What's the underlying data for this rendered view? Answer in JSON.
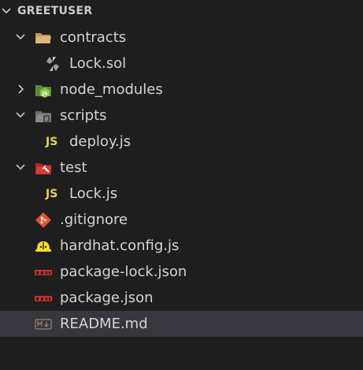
{
  "explorer": {
    "title": "GREETUSER",
    "items": [
      {
        "label": "contracts",
        "icon": "folder-open-icon"
      },
      {
        "label": "Lock.sol",
        "icon": "solidity-icon"
      },
      {
        "label": "node_modules",
        "icon": "node-folder-icon"
      },
      {
        "label": "scripts",
        "icon": "scripts-folder-icon"
      },
      {
        "label": "deploy.js",
        "icon": "js-icon",
        "badge": "JS"
      },
      {
        "label": "test",
        "icon": "test-folder-icon"
      },
      {
        "label": "Lock.js",
        "icon": "js-icon",
        "badge": "JS"
      },
      {
        "label": ".gitignore",
        "icon": "git-icon"
      },
      {
        "label": "hardhat.config.js",
        "icon": "hardhat-icon"
      },
      {
        "label": "package-lock.json",
        "icon": "npm-icon"
      },
      {
        "label": "package.json",
        "icon": "npm-icon"
      },
      {
        "label": "README.md",
        "icon": "markdown-icon"
      }
    ]
  },
  "colors": {
    "background": "#1e1e1e",
    "selected_row": "#37373d",
    "text": "#d4d4d4",
    "js_yellow": "#e8d44d",
    "npm_red": "#c9302c",
    "git_orange": "#e4532d",
    "hardhat_yellow": "#f5dc2a"
  }
}
